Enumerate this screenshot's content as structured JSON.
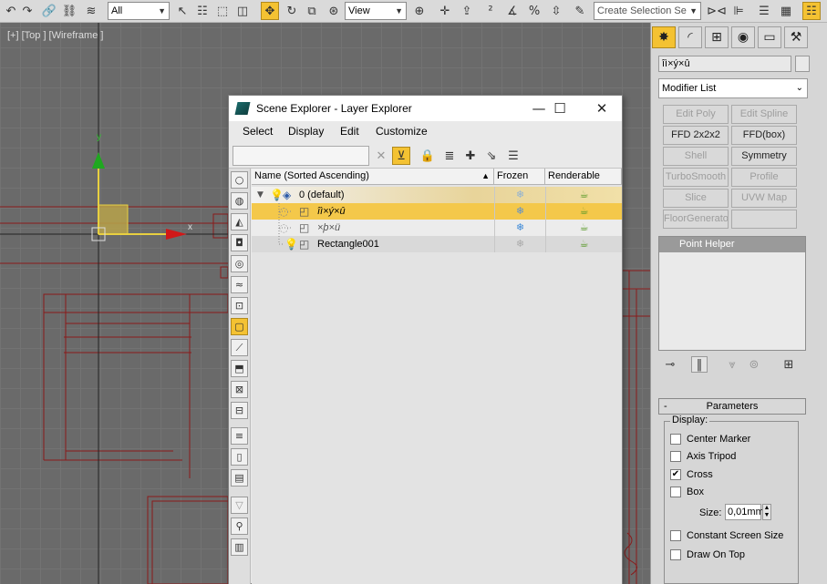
{
  "toolbar": {
    "selection_filter": "All",
    "ref_coord": "View",
    "named_selection_placeholder": "Create Selection Se"
  },
  "viewport": {
    "label": "[+] [Top ] [Wireframe ]",
    "gizmo_y": "y",
    "gizmo_x": "x"
  },
  "explorer": {
    "title": "Scene Explorer - Layer Explorer",
    "menu": [
      "Select",
      "Display",
      "Edit",
      "Customize"
    ],
    "columns": {
      "name": "Name (Sorted Ascending)",
      "frozen": "Frozen",
      "renderable": "Renderable"
    },
    "rows": [
      {
        "name": "0 (default)"
      },
      {
        "name": "îì×ý×û"
      },
      {
        "name": "×þ×ü"
      },
      {
        "name": "Rectangle001"
      }
    ]
  },
  "command_panel": {
    "object_name": "îì×ý×û",
    "modifier_list": "Modifier List",
    "modifier_buttons": [
      "Edit Poly",
      "Edit Spline",
      "FFD 2x2x2",
      "FFD(box)",
      "Shell",
      "Symmetry",
      "TurboSmooth",
      "Profile",
      "Slice",
      "UVW Map",
      "FloorGenerator",
      ""
    ],
    "stack_item": "Point Helper",
    "rollout_title": "Parameters",
    "rollout_minus": "-",
    "display_group": "Display:",
    "checkboxes": [
      {
        "label": "Center Marker",
        "checked": false
      },
      {
        "label": "Axis Tripod",
        "checked": false
      },
      {
        "label": "Cross",
        "checked": true
      },
      {
        "label": "Box",
        "checked": false
      }
    ],
    "size_label": "Size:",
    "size_value": "0,01mm",
    "checkboxes2": [
      {
        "label": "Constant Screen Size",
        "checked": false
      },
      {
        "label": "Draw On Top",
        "checked": false
      }
    ]
  }
}
